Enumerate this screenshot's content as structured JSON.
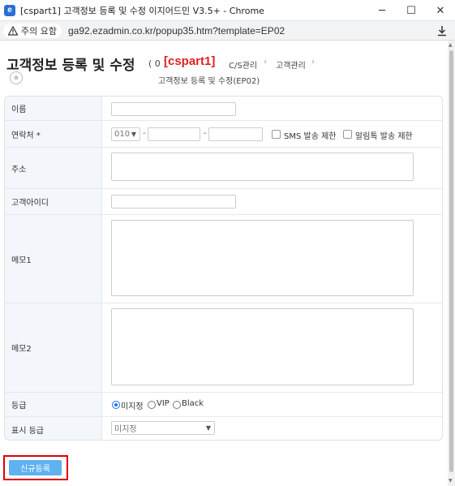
{
  "window": {
    "title": "[cspart1] 고객정보 등록 및 수정 이지어드민 V3.5+ - Chrome",
    "app_icon": "ezadmin-icon",
    "min_icon": "─",
    "max_icon": "☐",
    "close_icon": "✕"
  },
  "address_bar": {
    "warning": "주의 요함",
    "url": "ga92.ezadmin.co.kr/popup35.htm?template=EP02"
  },
  "header": {
    "title": "고객정보 등록 및 수정",
    "count": "( 0 )",
    "user": "[cspart1]",
    "breadcrumb": [
      "C/S관리",
      "고객관리"
    ],
    "subtitle": "고객정보 등록 및 수정(EP02)"
  },
  "form": {
    "name_label": "이름",
    "contact_label": "연락처 *",
    "phone_prefix": "010",
    "dash": "-",
    "sms_label": "SMS 발송 제한",
    "alimtalk_label": "알림톡 발송 제한",
    "address_label": "주소",
    "customer_id_label": "고객아이디",
    "memo1_label": "메모1",
    "memo2_label": "메모2",
    "grade_label": "등급",
    "grade_options": [
      "미지정",
      "VIP",
      "Black"
    ],
    "grade_selected": "미지정",
    "display_grade_label": "표시 등급",
    "display_grade_value": "미지정"
  },
  "actions": {
    "submit_label": "신규등록"
  },
  "colors": {
    "accent": "#5fb1f0",
    "highlight": "#e00000",
    "user": "#e02020"
  }
}
